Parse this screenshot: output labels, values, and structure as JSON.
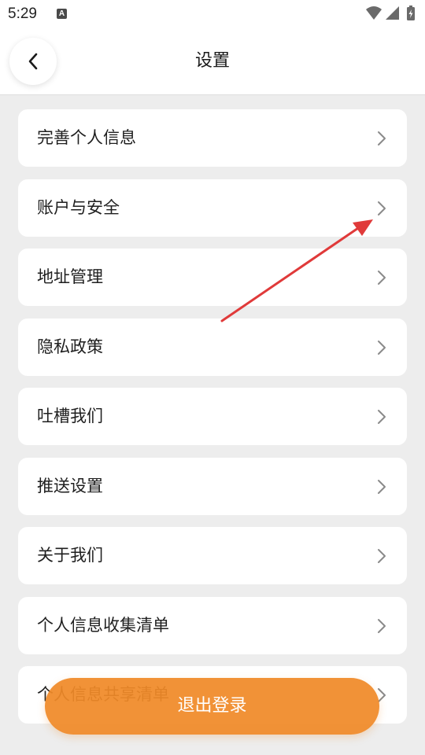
{
  "status_bar": {
    "time": "5:29",
    "notification_letter": "A",
    "icons": [
      "wifi-icon",
      "signal-icon",
      "battery-charging-icon"
    ]
  },
  "header": {
    "title": "设置",
    "back_icon": "chevron-left-icon"
  },
  "menu": {
    "items": [
      {
        "label": "完善个人信息"
      },
      {
        "label": "账户与安全"
      },
      {
        "label": "地址管理"
      },
      {
        "label": "隐私政策"
      },
      {
        "label": "吐槽我们"
      },
      {
        "label": "推送设置"
      },
      {
        "label": "关于我们"
      },
      {
        "label": "个人信息收集清单"
      },
      {
        "label": "个人信息共享清单"
      }
    ],
    "chevron_icon": "chevron-right-icon"
  },
  "footer": {
    "logout_label": "退出登录"
  },
  "colors": {
    "accent": "#F08A28",
    "annotation_arrow": "#E03A3A",
    "background": "#EDEDED",
    "card": "#FFFFFF"
  }
}
